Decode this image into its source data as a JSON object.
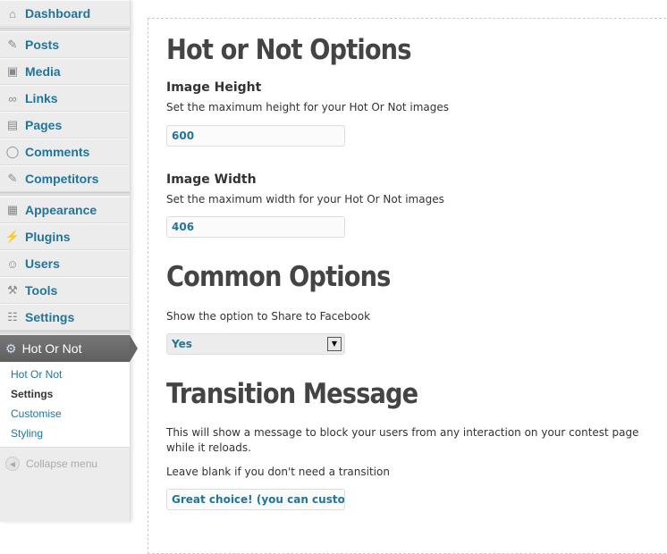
{
  "sidebar": {
    "items": [
      {
        "label": "Dashboard",
        "icon": "home-icon"
      },
      {
        "label": "Posts",
        "icon": "pin-icon"
      },
      {
        "label": "Media",
        "icon": "media-icon"
      },
      {
        "label": "Links",
        "icon": "link-icon"
      },
      {
        "label": "Pages",
        "icon": "pages-icon"
      },
      {
        "label": "Comments",
        "icon": "comment-icon"
      },
      {
        "label": "Competitors",
        "icon": "pin-icon"
      },
      {
        "label": "Appearance",
        "icon": "appearance-icon"
      },
      {
        "label": "Plugins",
        "icon": "plugin-icon"
      },
      {
        "label": "Users",
        "icon": "users-icon"
      },
      {
        "label": "Tools",
        "icon": "tools-icon"
      },
      {
        "label": "Settings",
        "icon": "settings-icon"
      }
    ],
    "active": {
      "label": "Hot Or Not",
      "icon": "gear-icon"
    },
    "submenu": [
      {
        "label": "Hot Or Not"
      },
      {
        "label": "Settings",
        "current": true
      },
      {
        "label": "Customise"
      },
      {
        "label": "Styling"
      }
    ],
    "collapse": "Collapse menu"
  },
  "main": {
    "title": "Hot or Not Options",
    "height": {
      "label": "Image Height",
      "desc": "Set the maximum height for your Hot Or Not images",
      "value": "600"
    },
    "width": {
      "label": "Image Width",
      "desc": "Set the maximum width for your Hot Or Not images",
      "value": "406"
    },
    "common_title": "Common Options",
    "share": {
      "desc": "Show the option to Share to Facebook",
      "value": "Yes"
    },
    "transition_title": "Transition Message",
    "transition": {
      "desc": "This will show a message to block your users from any interaction on your contest page while it reloads.",
      "hint": "Leave blank if you don't need a transition",
      "value": "Great choice! (you can customise this message)"
    }
  },
  "colors": {
    "link": "#21759b",
    "sidebar_bg": "#ececec",
    "active_bg": "#666666",
    "heading": "#444444"
  }
}
